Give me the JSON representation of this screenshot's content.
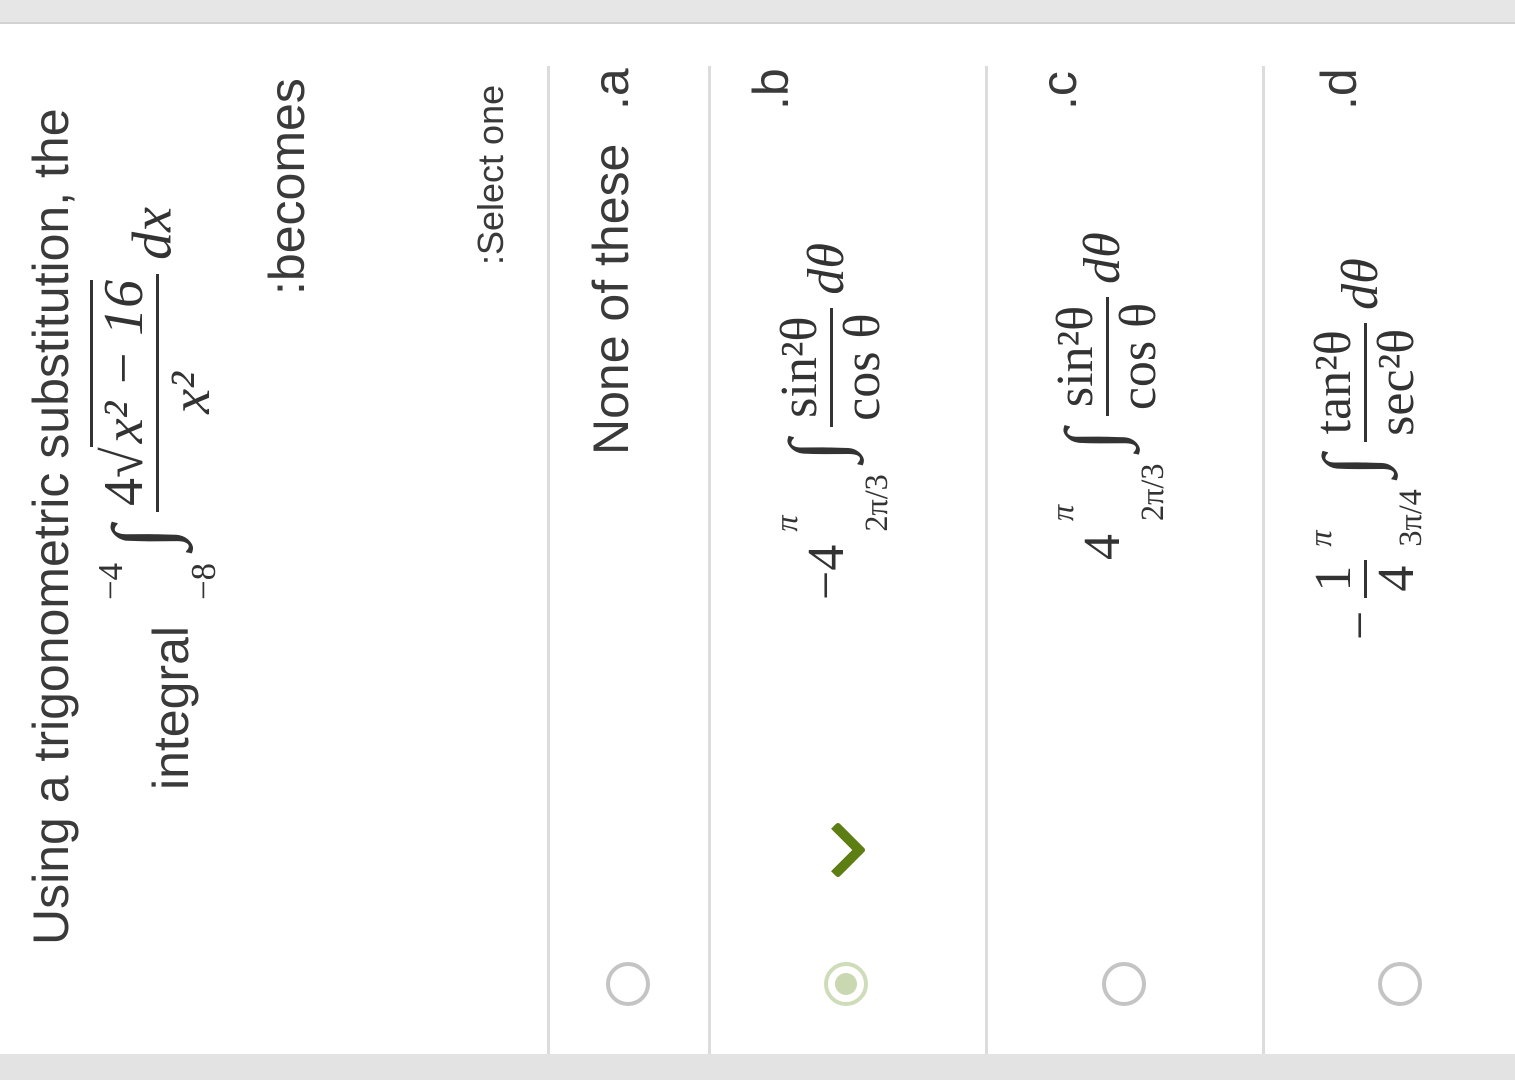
{
  "question": {
    "line1": "Using a trigonometric substitution, the",
    "line2_prefix": "integral",
    "integral": {
      "lower": "−8",
      "upper": "−4",
      "numerator_coeff": "4",
      "radicand": "x² − 16",
      "denominator": "x²",
      "differential": "dx"
    },
    "line3": ":becomes"
  },
  "prompt": ":Select one",
  "options": [
    {
      "letter": ".a",
      "text": "None of these",
      "selected": false
    },
    {
      "letter": ".b",
      "coeff": "−4",
      "lower": "2π/3",
      "upper": "π",
      "numerator": "sin²θ",
      "denominator": "cos θ",
      "differential": "dθ",
      "selected": true,
      "correct": true
    },
    {
      "letter": ".c",
      "coeff": "4",
      "lower": "2π/3",
      "upper": "π",
      "numerator": "sin²θ",
      "denominator": "cos θ",
      "differential": "dθ",
      "selected": false
    },
    {
      "letter": ".d",
      "coeff_sign": "−",
      "coeff_num": "1",
      "coeff_den": "4",
      "lower": "3π/4",
      "upper": "π",
      "numerator": "tan²θ",
      "denominator": "sec²θ",
      "differential": "dθ",
      "selected": false
    }
  ],
  "colors": {
    "selected_radio": "#c9d8b0",
    "check_mark": "#5c7e13",
    "divider": "#dcdcdc"
  },
  "icons": {
    "selected": "radio-selected-icon",
    "correct": "check-icon"
  }
}
